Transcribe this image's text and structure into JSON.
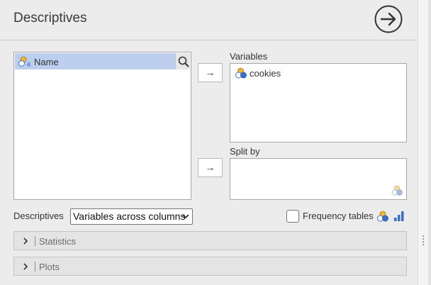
{
  "header": {
    "title": "Descriptives",
    "run_icon": "arrow-circle-right-icon"
  },
  "source_list": {
    "items": [
      {
        "label": "Name",
        "icon": "nominal-text-icon"
      }
    ],
    "search_icon": "search-icon"
  },
  "variables": {
    "label": "Variables",
    "items": [
      {
        "label": "cookies",
        "icon": "nominal-variable-icon"
      }
    ]
  },
  "split_by": {
    "label": "Split by",
    "items": [],
    "hint_icon": "nominal-variable-icon"
  },
  "move_buttons": {
    "symbol": "→"
  },
  "options": {
    "descriptives_label": "Descriptives",
    "layout_select_value": "Variables across columns",
    "frequency_tables_label": "Frequency tables",
    "frequency_tables_checked": false
  },
  "sections": [
    {
      "label": "Statistics"
    },
    {
      "label": "Plots"
    }
  ],
  "colors": {
    "selection": "#bccfef",
    "accent_blue": "#3b6fc4",
    "nominal_orange": "#f2b53a"
  }
}
